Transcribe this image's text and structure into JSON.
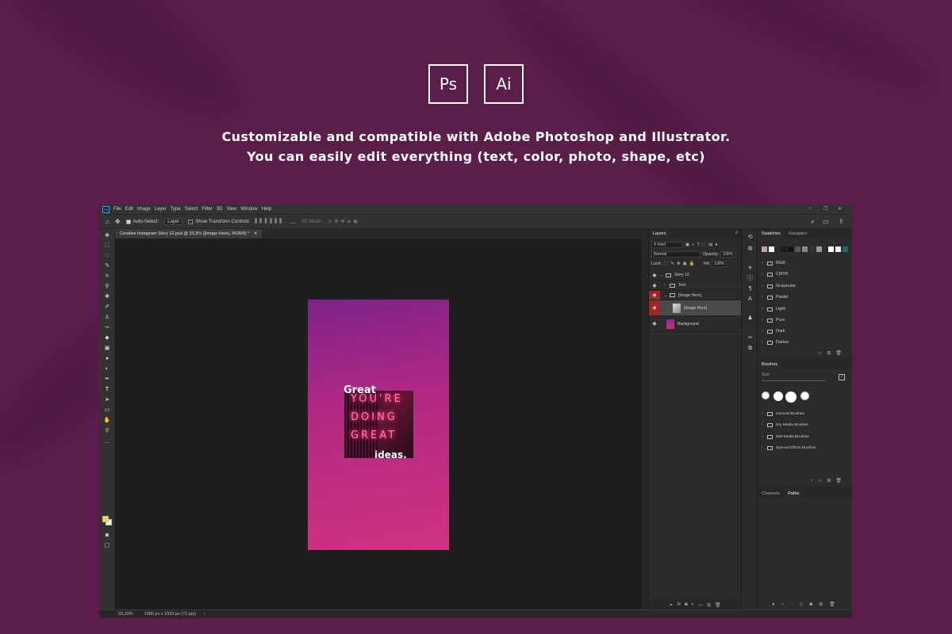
{
  "badges": [
    "Ps",
    "Ai"
  ],
  "tagline": {
    "line1": "Customizable and compatible with Adobe Photoshop and Illustrator.",
    "line2": "You can easily edit everything (text, color, photo, shape, etc)"
  },
  "photoshop": {
    "menu": [
      "File",
      "Edit",
      "Image",
      "Layer",
      "Type",
      "Select",
      "Filter",
      "3D",
      "View",
      "Window",
      "Help"
    ],
    "options": {
      "auto_select": "Auto-Select:",
      "layer_select": "Layer",
      "show_transform": "Show Transform Controls",
      "mode_3d": "3D Mode:"
    },
    "doc_tab": "Creative Instagram Story 12.psd @ 33,3% ([Image Here], RGB/8) *",
    "status": {
      "zoom": "33,33%",
      "doc_info": "1080 px x 1920 px (72 ppi)"
    },
    "artwork": {
      "headline": "Great",
      "neon_lines": [
        "YOU'RE",
        "DOING",
        "GREAT"
      ],
      "tail": "ideas."
    },
    "layers_panel": {
      "tab": "Layers",
      "kind": "Kind",
      "blend_mode": "Normal",
      "opacity_label": "Opacity:",
      "opacity_value": "100%",
      "lock_label": "Lock:",
      "fill_label": "Fill:",
      "fill_value": "100%",
      "layers": [
        {
          "name": "Story 12"
        },
        {
          "name": "Text"
        },
        {
          "name": "[Image Here]"
        },
        {
          "name": "[Image Here]"
        },
        {
          "name": "Background"
        }
      ]
    },
    "swatches_panel": {
      "tabs": [
        "Swatches",
        "Navigator"
      ],
      "groups": [
        "RGB",
        "CMYK",
        "Grayscale",
        "Pastel",
        "Light",
        "Pure",
        "Dark",
        "Darker"
      ]
    },
    "brushes_panel": {
      "tab": "Brushes",
      "size_label": "Size:",
      "groups": [
        "General Brushes",
        "Dry Media Brushes",
        "Wet Media Brushes",
        "Special Effects Brushes"
      ]
    },
    "channels_panel": {
      "tabs": [
        "Channels",
        "Paths"
      ]
    }
  }
}
